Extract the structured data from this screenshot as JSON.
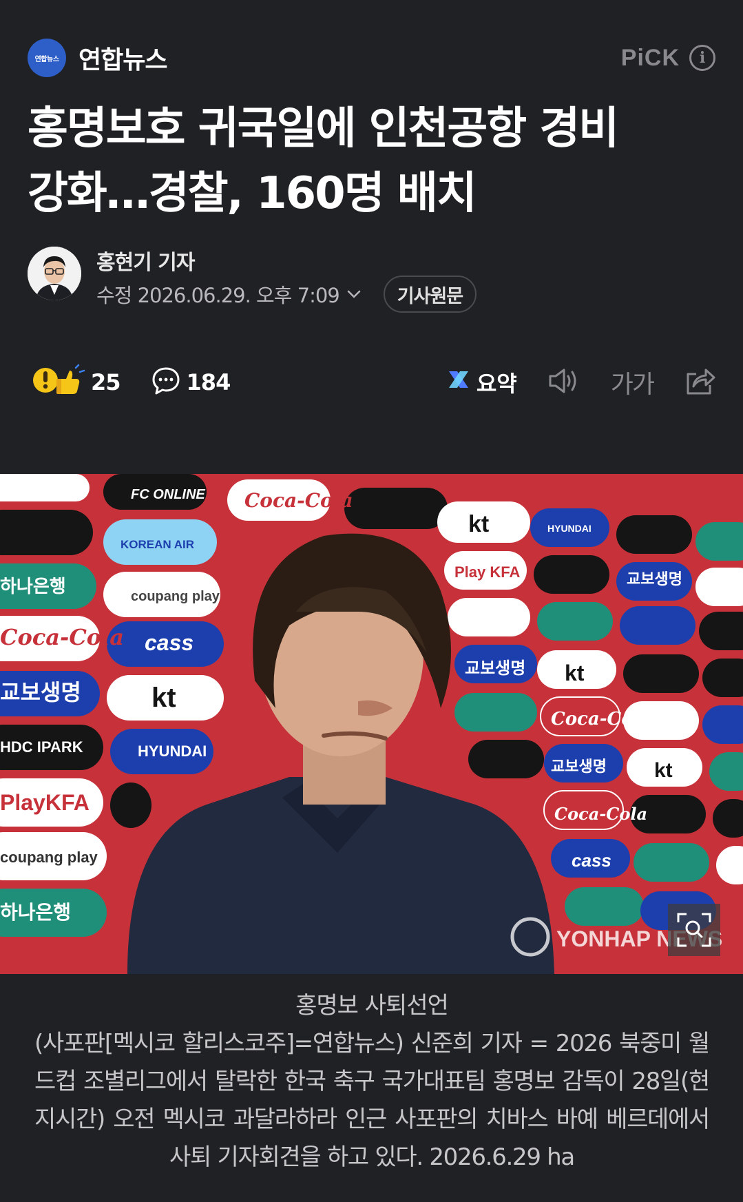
{
  "press": {
    "logo_text": "연합뉴스",
    "name": "연합뉴스",
    "brand_color": "#2e5fc8"
  },
  "pick": {
    "label": "PiCK",
    "info_icon": "info-icon"
  },
  "article": {
    "headline_line1": "홍명보호 귀국일에 인천공항 경비",
    "headline_line2": "강화…경찰, 160명 배치"
  },
  "author": {
    "name": "홍현기 기자",
    "modified": "수정 2026.06.29. 오후 7:09",
    "original_button": "기사원문"
  },
  "actions": {
    "reaction_count": "25",
    "comment_count": "184",
    "summary_label": "요약",
    "font_size_label": "가가",
    "icons": [
      "reaction-emoji-icon",
      "comment-icon",
      "summary-icon",
      "speaker-icon",
      "font-size-icon",
      "share-icon"
    ]
  },
  "photo": {
    "watermark": "YONHAP NEWS",
    "sponsor_boards": [
      "kt",
      "FC ONLINE",
      "Coca-Cola",
      "KOREAN AIR",
      "하나은행",
      "coupang play",
      "cass",
      "교보생명",
      "HDC IPARK",
      "Play KFA",
      "HYUNDAI"
    ]
  },
  "caption": {
    "title": "홍명보 사퇴선언",
    "body": "(사포판[멕시코 할리스코주]=연합뉴스) 신준희 기자 = 2026 북중미 월드컵 조별리그에서 탈락한 한국 축구 국가대표팀 홍명보 감독이 28일(현지시간) 오전 멕시코 과달라하라 인근 사포판의 치바스 바예 베르데에서 사퇴 기자회견을 하고 있다. 2026.6.29 ha"
  }
}
